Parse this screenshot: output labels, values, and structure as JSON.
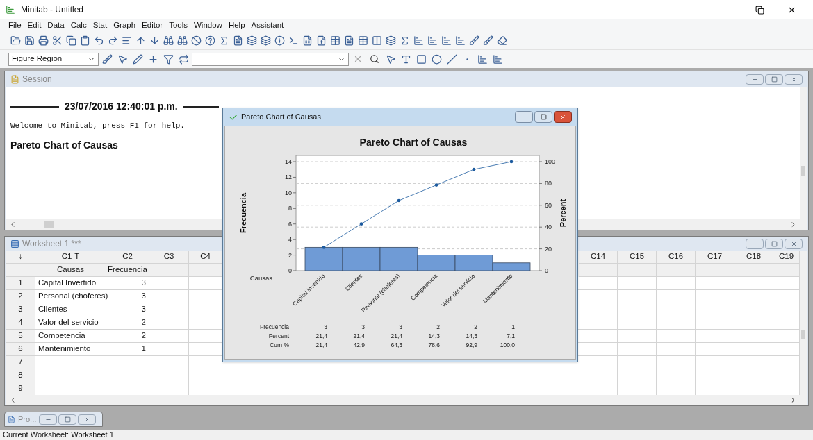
{
  "window": {
    "title": "Minitab - Untitled"
  },
  "menu": [
    "File",
    "Edit",
    "Data",
    "Calc",
    "Stat",
    "Graph",
    "Editor",
    "Tools",
    "Window",
    "Help",
    "Assistant"
  ],
  "toolbar": {
    "figure_region": {
      "value": "Figure Region"
    }
  },
  "session": {
    "title": "Session",
    "timestamp": "23/07/2016 12:40:01 p.m.",
    "welcome": "Welcome to Minitab, press F1 for help.",
    "heading": "Pareto Chart of Causas"
  },
  "worksheet": {
    "title": "Worksheet 1 ***",
    "corner": "↓",
    "columns": [
      {
        "id": "C1-T",
        "name": "Causas"
      },
      {
        "id": "C2",
        "name": "Frecuencia"
      },
      {
        "id": "C3"
      },
      {
        "id": "C4"
      }
    ],
    "columns_right": [
      {
        "id": "C14"
      },
      {
        "id": "C15"
      },
      {
        "id": "C16"
      },
      {
        "id": "C17"
      },
      {
        "id": "C18"
      },
      {
        "id": "C19"
      }
    ],
    "rows": [
      {
        "number": "1",
        "cause": "Capital Invertido",
        "frequency": "3"
      },
      {
        "number": "2",
        "cause": "Personal (choferes)",
        "frequency": "3"
      },
      {
        "number": "3",
        "cause": "Clientes",
        "frequency": "3"
      },
      {
        "number": "4",
        "cause": "Valor del servicio",
        "frequency": "2"
      },
      {
        "number": "5",
        "cause": "Competencia",
        "frequency": "2"
      },
      {
        "number": "6",
        "cause": "Mantenimiento",
        "frequency": "1"
      },
      {
        "number": "7"
      },
      {
        "number": "8"
      },
      {
        "number": "9"
      }
    ]
  },
  "graph_window": {
    "title": "Pareto Chart of Causas",
    "chart_data": {
      "type": "bar",
      "title": "Pareto Chart of Causas",
      "xlabel": "Causas",
      "ylabel": "Frecuencia",
      "y2label": "Percent",
      "grid": true,
      "categories": [
        "Capital Invertido",
        "Clientes",
        "Personal (choferes)",
        "Competencia",
        "Valor del servicio",
        "Mantenimiento"
      ],
      "series": [
        {
          "type": "bar",
          "color": "#6f9bd6",
          "values": [
            3,
            3,
            3,
            2,
            2,
            1
          ]
        },
        {
          "type": "line",
          "axis": "y2",
          "color": "#1c5a9e",
          "values": [
            21.4,
            42.9,
            64.3,
            78.6,
            92.9,
            100
          ]
        }
      ],
      "ylim": [
        0,
        14
      ],
      "yticks": [
        0,
        2,
        4,
        6,
        8,
        10,
        12,
        14
      ],
      "y2lim": [
        0,
        100
      ],
      "y2ticks": [
        0,
        20,
        40,
        60,
        80,
        100
      ]
    },
    "table": [
      {
        "label": "Frecuencia",
        "values": [
          "3",
          "3",
          "3",
          "2",
          "2",
          "1"
        ]
      },
      {
        "label": "Percent",
        "values": [
          "21,4",
          "21,4",
          "21,4",
          "14,3",
          "14,3",
          "7,1"
        ]
      },
      {
        "label": "Cum %",
        "values": [
          "21,4",
          "42,9",
          "64,3",
          "78,6",
          "92,9",
          "100,0"
        ]
      }
    ]
  },
  "minimized": {
    "title": "Pro..."
  },
  "status_bar": {
    "text": "Current Worksheet: Worksheet 1"
  }
}
